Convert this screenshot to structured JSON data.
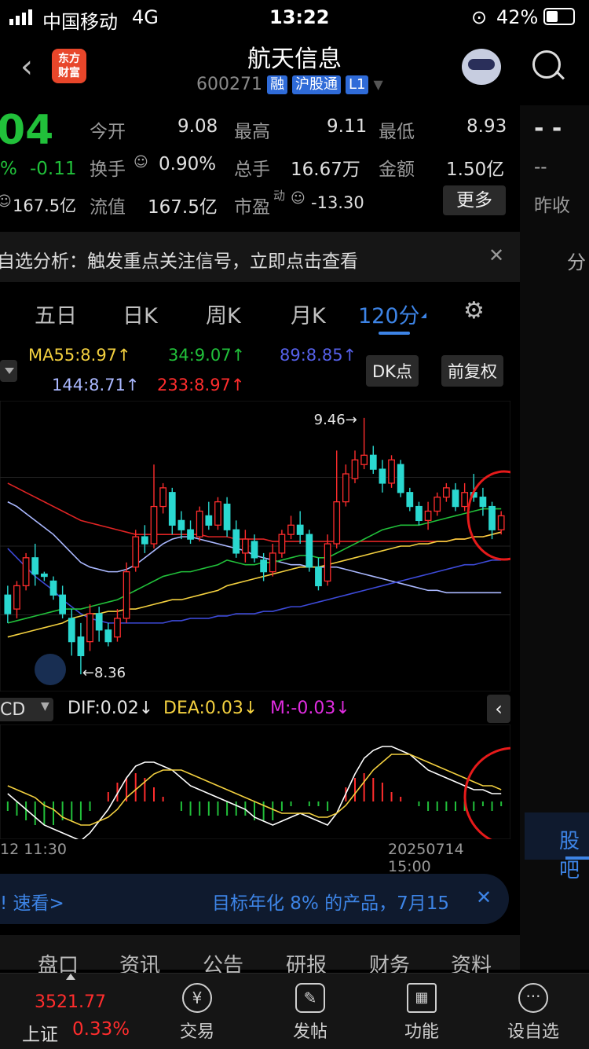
{
  "status_bar": {
    "carrier": "中国移动",
    "network": "4G",
    "time": "13:22",
    "battery": "42%"
  },
  "header": {
    "title": "航天信息",
    "code": "600271",
    "tags": [
      "融",
      "沪股通",
      "L1"
    ],
    "logo_line1": "东方",
    "logo_line2": "财富"
  },
  "quote": {
    "price_partial": "04",
    "pct_partial": "%",
    "change": "-0.11",
    "cap_partial": "167.5亿",
    "rows": [
      [
        {
          "label": "今开",
          "value": "9.08",
          "color": "green"
        },
        {
          "label": "最高",
          "value": "9.11",
          "color": "green"
        },
        {
          "label": "最低",
          "value": "8.93",
          "color": "green"
        }
      ],
      [
        {
          "label": "换手",
          "value": "0.90%",
          "color": "white"
        },
        {
          "label": "总手",
          "value": "16.67万",
          "color": "white"
        },
        {
          "label": "金额",
          "value": "1.50亿",
          "color": "white"
        }
      ],
      [
        {
          "label": "流值",
          "value": "167.5亿",
          "color": "white"
        },
        {
          "label": "市盈",
          "sup": "动",
          "value": "-13.30",
          "color": "white"
        }
      ]
    ],
    "more_button": "更多",
    "prev_close_value": "- -",
    "prev_close_dash": "--",
    "prev_close_label": "昨收"
  },
  "notice": {
    "text": "自选分析：触发重点关注信号，立即点击查看",
    "right_partial": "分"
  },
  "tabs": {
    "items": [
      "五日",
      "日K",
      "周K",
      "月K",
      "120分"
    ],
    "active": "120分"
  },
  "ma": {
    "row1": [
      {
        "text": "MA55:8.97↑",
        "color": "#f3d03f"
      },
      {
        "text": "34:9.07↑",
        "color": "#21c03a"
      },
      {
        "text": "89:8.85↑",
        "color": "#5560e8"
      }
    ],
    "row2": [
      {
        "text": "144:8.71↑",
        "color": "#aab8ff"
      },
      {
        "text": "233:8.97↑",
        "color": "#ff2d2d"
      }
    ],
    "dk_button": "DK点",
    "fq_button": "前复权"
  },
  "chart_data": {
    "type": "candlestick",
    "high_label": "9.46",
    "low_label": "8.36",
    "candles": [
      {
        "o": 8.7,
        "c": 8.62,
        "h": 8.74,
        "l": 8.58
      },
      {
        "o": 8.64,
        "c": 8.74,
        "h": 8.76,
        "l": 8.6
      },
      {
        "o": 8.74,
        "c": 8.86,
        "h": 8.88,
        "l": 8.72
      },
      {
        "o": 8.86,
        "c": 8.79,
        "h": 8.92,
        "l": 8.74
      },
      {
        "o": 8.79,
        "c": 8.78,
        "h": 8.8,
        "l": 8.76
      },
      {
        "o": 8.76,
        "c": 8.7,
        "h": 8.78,
        "l": 8.68
      },
      {
        "o": 8.7,
        "c": 8.62,
        "h": 8.74,
        "l": 8.6
      },
      {
        "o": 8.6,
        "c": 8.5,
        "h": 8.64,
        "l": 8.44
      },
      {
        "o": 8.52,
        "c": 8.44,
        "h": 8.58,
        "l": 8.36
      },
      {
        "o": 8.5,
        "c": 8.62,
        "h": 8.66,
        "l": 8.46
      },
      {
        "o": 8.62,
        "c": 8.55,
        "h": 8.65,
        "l": 8.5
      },
      {
        "o": 8.55,
        "c": 8.5,
        "h": 8.58,
        "l": 8.48
      },
      {
        "o": 8.52,
        "c": 8.6,
        "h": 8.64,
        "l": 8.5
      },
      {
        "o": 8.6,
        "c": 8.8,
        "h": 8.84,
        "l": 8.58
      },
      {
        "o": 8.82,
        "c": 8.95,
        "h": 8.98,
        "l": 8.8
      },
      {
        "o": 8.95,
        "c": 8.92,
        "h": 9.0,
        "l": 8.88
      },
      {
        "o": 8.92,
        "c": 9.08,
        "h": 9.26,
        "l": 8.9
      },
      {
        "o": 9.08,
        "c": 9.16,
        "h": 9.18,
        "l": 9.05
      },
      {
        "o": 9.14,
        "c": 9.0,
        "h": 9.16,
        "l": 8.96
      },
      {
        "o": 9.02,
        "c": 8.98,
        "h": 9.06,
        "l": 8.94
      },
      {
        "o": 8.98,
        "c": 8.94,
        "h": 9.02,
        "l": 8.92
      },
      {
        "o": 8.95,
        "c": 9.06,
        "h": 9.08,
        "l": 8.93
      },
      {
        "o": 9.04,
        "c": 9.0,
        "h": 9.1,
        "l": 8.98
      },
      {
        "o": 9.0,
        "c": 9.1,
        "h": 9.12,
        "l": 8.98
      },
      {
        "o": 9.09,
        "c": 8.98,
        "h": 9.12,
        "l": 8.95
      },
      {
        "o": 8.98,
        "c": 8.88,
        "h": 9.02,
        "l": 8.86
      },
      {
        "o": 8.88,
        "c": 8.94,
        "h": 8.98,
        "l": 8.84
      },
      {
        "o": 8.93,
        "c": 8.86,
        "h": 8.96,
        "l": 8.84
      },
      {
        "o": 8.85,
        "c": 8.8,
        "h": 8.88,
        "l": 8.76
      },
      {
        "o": 8.8,
        "c": 8.88,
        "h": 8.92,
        "l": 8.78
      },
      {
        "o": 8.88,
        "c": 8.96,
        "h": 8.98,
        "l": 8.86
      },
      {
        "o": 8.96,
        "c": 9.0,
        "h": 9.04,
        "l": 8.94
      },
      {
        "o": 9.0,
        "c": 8.96,
        "h": 9.06,
        "l": 8.92
      },
      {
        "o": 8.96,
        "c": 8.82,
        "h": 8.98,
        "l": 8.8
      },
      {
        "o": 8.82,
        "c": 8.74,
        "h": 8.86,
        "l": 8.72
      },
      {
        "o": 8.76,
        "c": 8.92,
        "h": 8.96,
        "l": 8.74
      },
      {
        "o": 8.92,
        "c": 9.1,
        "h": 9.32,
        "l": 8.9
      },
      {
        "o": 9.1,
        "c": 9.22,
        "h": 9.26,
        "l": 9.08
      },
      {
        "o": 9.2,
        "c": 9.28,
        "h": 9.32,
        "l": 9.18
      },
      {
        "o": 9.26,
        "c": 9.3,
        "h": 9.46,
        "l": 9.24
      },
      {
        "o": 9.3,
        "c": 9.24,
        "h": 9.34,
        "l": 9.22
      },
      {
        "o": 9.24,
        "c": 9.18,
        "h": 9.28,
        "l": 9.14
      },
      {
        "o": 9.18,
        "c": 9.28,
        "h": 9.3,
        "l": 9.16
      },
      {
        "o": 9.26,
        "c": 9.14,
        "h": 9.28,
        "l": 9.12
      },
      {
        "o": 9.14,
        "c": 9.08,
        "h": 9.16,
        "l": 9.06
      },
      {
        "o": 9.08,
        "c": 9.02,
        "h": 9.1,
        "l": 9.0
      },
      {
        "o": 9.02,
        "c": 9.06,
        "h": 9.1,
        "l": 8.98
      },
      {
        "o": 9.06,
        "c": 9.12,
        "h": 9.14,
        "l": 9.04
      },
      {
        "o": 9.12,
        "c": 9.16,
        "h": 9.18,
        "l": 9.1
      },
      {
        "o": 9.15,
        "c": 9.08,
        "h": 9.18,
        "l": 9.06
      },
      {
        "o": 9.08,
        "c": 9.14,
        "h": 9.18,
        "l": 9.06
      },
      {
        "o": 9.14,
        "c": 9.12,
        "h": 9.22,
        "l": 9.1
      },
      {
        "o": 9.12,
        "c": 9.08,
        "h": 9.16,
        "l": 9.04
      },
      {
        "o": 9.08,
        "c": 8.98,
        "h": 9.1,
        "l": 8.94
      },
      {
        "o": 8.98,
        "c": 9.04,
        "h": 9.06,
        "l": 8.96
      }
    ],
    "ma_lines": [
      {
        "name": "MA233",
        "color": "#e02424",
        "values": [
          9.18,
          9.16,
          9.14,
          9.12,
          9.1,
          9.08,
          9.06,
          9.04,
          9.02,
          9.01,
          9.0,
          8.99,
          8.98,
          8.97,
          8.96,
          8.96,
          8.96,
          8.96,
          8.96,
          8.96,
          8.96,
          8.96,
          8.95,
          8.95,
          8.95,
          8.94,
          8.94,
          8.94,
          8.94,
          8.93,
          8.93,
          8.93,
          8.93,
          8.93,
          8.93,
          8.93,
          8.93,
          8.93,
          8.93,
          8.93,
          8.93,
          8.93,
          8.93,
          8.93,
          8.93,
          8.93,
          8.93,
          8.93,
          8.93,
          8.94,
          8.94,
          8.95,
          8.95,
          8.96,
          8.97
        ]
      },
      {
        "name": "MA144",
        "color": "#aab8ff",
        "values": [
          9.1,
          9.08,
          9.05,
          9.02,
          8.99,
          8.96,
          8.92,
          8.88,
          8.84,
          8.82,
          8.81,
          8.8,
          8.8,
          8.81,
          8.83,
          8.86,
          8.89,
          8.92,
          8.94,
          8.95,
          8.95,
          8.94,
          8.93,
          8.92,
          8.91,
          8.9,
          8.89,
          8.87,
          8.86,
          8.85,
          8.84,
          8.83,
          8.83,
          8.82,
          8.82,
          8.82,
          8.82,
          8.81,
          8.8,
          8.79,
          8.78,
          8.77,
          8.76,
          8.75,
          8.74,
          8.73,
          8.72,
          8.72,
          8.71,
          8.71,
          8.71,
          8.71,
          8.71,
          8.71,
          8.71
        ]
      },
      {
        "name": "MA89",
        "color": "#3d4ad8",
        "values": [
          8.9,
          8.86,
          8.82,
          8.78,
          8.75,
          8.72,
          8.68,
          8.65,
          8.62,
          8.6,
          8.59,
          8.58,
          8.58,
          8.58,
          8.58,
          8.58,
          8.58,
          8.58,
          8.59,
          8.59,
          8.6,
          8.6,
          8.6,
          8.61,
          8.61,
          8.62,
          8.62,
          8.62,
          8.63,
          8.63,
          8.64,
          8.65,
          8.65,
          8.66,
          8.67,
          8.68,
          8.69,
          8.7,
          8.71,
          8.72,
          8.73,
          8.74,
          8.75,
          8.76,
          8.77,
          8.78,
          8.79,
          8.8,
          8.81,
          8.82,
          8.83,
          8.83,
          8.84,
          8.85,
          8.85
        ]
      },
      {
        "name": "MA55",
        "color": "#f3d03f",
        "values": [
          8.52,
          8.53,
          8.54,
          8.55,
          8.56,
          8.57,
          8.58,
          8.6,
          8.61,
          8.62,
          8.62,
          8.63,
          8.63,
          8.64,
          8.64,
          8.65,
          8.66,
          8.67,
          8.68,
          8.68,
          8.69,
          8.7,
          8.71,
          8.72,
          8.74,
          8.75,
          8.76,
          8.77,
          8.78,
          8.79,
          8.8,
          8.81,
          8.82,
          8.82,
          8.82,
          8.83,
          8.84,
          8.85,
          8.86,
          8.87,
          8.88,
          8.89,
          8.9,
          8.91,
          8.91,
          8.92,
          8.92,
          8.93,
          8.93,
          8.94,
          8.94,
          8.95,
          8.95,
          8.96,
          8.97
        ]
      },
      {
        "name": "MA34",
        "color": "#21c03a",
        "values": [
          8.58,
          8.59,
          8.6,
          8.61,
          8.62,
          8.63,
          8.64,
          8.64,
          8.64,
          8.65,
          8.66,
          8.67,
          8.68,
          8.7,
          8.72,
          8.74,
          8.76,
          8.78,
          8.79,
          8.8,
          8.8,
          8.81,
          8.82,
          8.83,
          8.85,
          8.84,
          8.83,
          8.83,
          8.84,
          8.84,
          8.85,
          8.86,
          8.87,
          8.87,
          8.86,
          8.86,
          8.88,
          8.9,
          8.92,
          8.94,
          8.96,
          8.98,
          8.99,
          9.0,
          9.0,
          9.0,
          9.01,
          9.02,
          9.03,
          9.04,
          9.05,
          9.06,
          9.07,
          9.07,
          9.07
        ]
      }
    ],
    "ylim": [
      8.32,
      9.5
    ],
    "macd": {
      "dif": [
        0.02,
        0.0,
        -0.02,
        -0.04,
        -0.06,
        -0.07,
        -0.08,
        -0.09,
        -0.1,
        -0.08,
        -0.05,
        -0.02,
        0.02,
        0.06,
        0.09,
        0.1,
        0.1,
        0.09,
        0.08,
        0.06,
        0.04,
        0.03,
        0.02,
        0.01,
        0.0,
        -0.01,
        -0.02,
        -0.04,
        -0.05,
        -0.06,
        -0.05,
        -0.04,
        -0.03,
        -0.04,
        -0.05,
        -0.06,
        -0.03,
        0.02,
        0.07,
        0.11,
        0.13,
        0.14,
        0.14,
        0.13,
        0.12,
        0.1,
        0.08,
        0.07,
        0.06,
        0.05,
        0.04,
        0.03,
        0.03,
        0.02,
        0.02
      ],
      "dea": [
        0.04,
        0.03,
        0.02,
        0.01,
        -0.01,
        -0.02,
        -0.04,
        -0.05,
        -0.06,
        -0.06,
        -0.05,
        -0.04,
        -0.02,
        0.01,
        0.03,
        0.05,
        0.07,
        0.08,
        0.08,
        0.08,
        0.07,
        0.06,
        0.05,
        0.04,
        0.03,
        0.02,
        0.01,
        0.0,
        -0.01,
        -0.02,
        -0.03,
        -0.03,
        -0.03,
        -0.03,
        -0.04,
        -0.04,
        -0.03,
        -0.01,
        0.02,
        0.05,
        0.08,
        0.1,
        0.12,
        0.12,
        0.12,
        0.11,
        0.1,
        0.09,
        0.08,
        0.07,
        0.06,
        0.05,
        0.04,
        0.04,
        0.03
      ],
      "m": [
        -0.02,
        -0.03,
        -0.04,
        -0.05,
        -0.05,
        -0.05,
        -0.04,
        -0.04,
        -0.04,
        -0.02,
        0.0,
        0.02,
        0.04,
        0.05,
        0.06,
        0.05,
        0.03,
        0.01,
        0.0,
        -0.02,
        -0.03,
        -0.03,
        -0.03,
        -0.03,
        -0.03,
        -0.03,
        -0.03,
        -0.04,
        -0.04,
        -0.04,
        -0.02,
        -0.01,
        0.0,
        -0.01,
        -0.01,
        -0.02,
        0.0,
        0.03,
        0.05,
        0.06,
        0.05,
        0.04,
        0.02,
        0.01,
        0.0,
        -0.01,
        -0.02,
        -0.02,
        -0.02,
        -0.02,
        -0.02,
        -0.02,
        -0.01,
        -0.02,
        -0.01
      ]
    }
  },
  "macd_header": {
    "name": "CD",
    "dif": "DIF:0.02↓",
    "dea": "DEA:0.03↓",
    "m": "M:-0.03↓"
  },
  "dates": {
    "left": "12 11:30",
    "right": "20250714 15:00"
  },
  "side": {
    "label": "股吧"
  },
  "ad": {
    "left": "! 速看>",
    "right": "目标年化 8% 的产品，7月15"
  },
  "bottom_tabs": [
    "盘口",
    "资讯",
    "公告",
    "研报",
    "财务",
    "资料"
  ],
  "footer": {
    "index_value": "3521.77",
    "index_name": "上证",
    "index_pct": "0.33%",
    "items": [
      {
        "label": "交易"
      },
      {
        "label": "发帖"
      },
      {
        "label": "功能"
      },
      {
        "label": "设自选"
      }
    ]
  }
}
